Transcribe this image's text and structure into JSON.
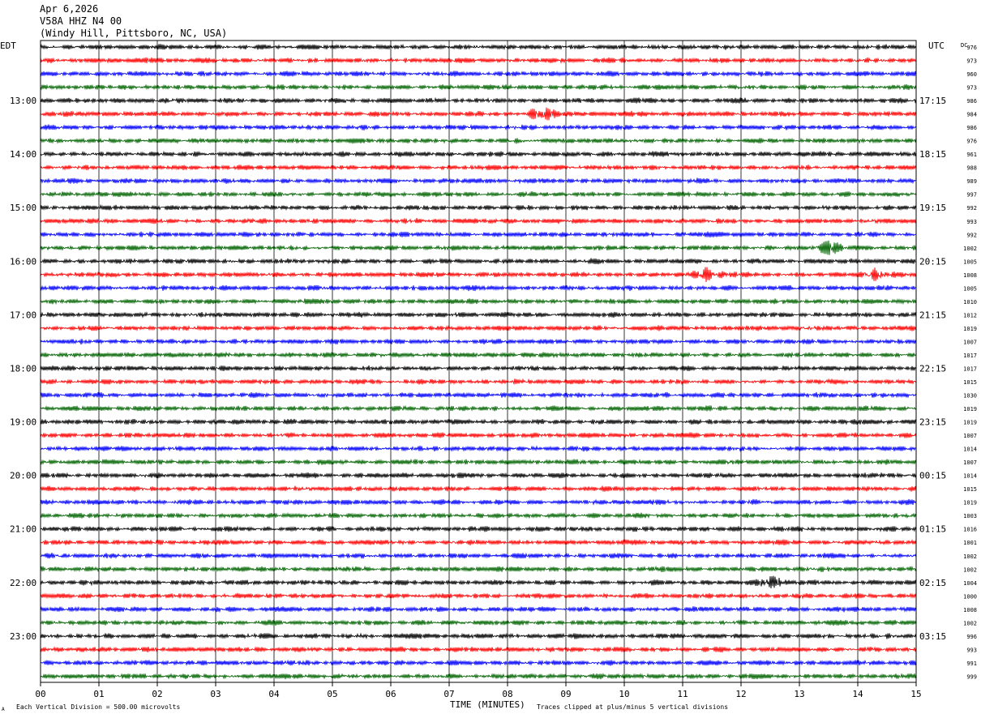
{
  "header": {
    "date": "Apr 6,2026",
    "station": "V58A HHZ N4 00",
    "location": "(Windy Hill, Pittsboro, NC, USA)"
  },
  "labels": {
    "left_tz": "EDT",
    "right_tz": "UTC",
    "dc": "DC",
    "xlabel": "TIME (MINUTES)",
    "scale_note": "Each Vertical Division =  500.00 microvolts",
    "clip_note": "Traces clipped at plus/minus 5 vertical divisions",
    "corner_mark": "A"
  },
  "colors": {
    "trace_cycle": [
      "#000000",
      "#ff0000",
      "#0000ff",
      "#006400"
    ],
    "grid": "#000000",
    "background": "#ffffff"
  },
  "chart_data": {
    "type": "line",
    "description_type": "helicorder",
    "x_ticks": [
      "00",
      "01",
      "02",
      "03",
      "04",
      "05",
      "06",
      "07",
      "08",
      "09",
      "10",
      "11",
      "12",
      "13",
      "14",
      "15"
    ],
    "xlim": [
      0,
      15
    ],
    "left_hour_labels": [
      "13:00",
      "14:00",
      "15:00",
      "16:00",
      "17:00",
      "18:00",
      "19:00",
      "20:00",
      "21:00",
      "22:00",
      "23:00"
    ],
    "right_hour_labels": [
      "17:15",
      "18:15",
      "19:15",
      "20:15",
      "21:15",
      "22:15",
      "23:15",
      "00:15",
      "01:15",
      "02:15",
      "03:15"
    ],
    "dc_values": [
      976,
      973,
      960,
      973,
      986,
      984,
      986,
      976,
      961,
      988,
      989,
      997,
      992,
      993,
      992,
      1002,
      1005,
      1008,
      1005,
      1010,
      1012,
      1019,
      1007,
      1017,
      1017,
      1015,
      1030,
      1019,
      1019,
      1007,
      1014,
      1007,
      1014,
      1015,
      1019,
      1003,
      1016,
      1001,
      1002,
      1002,
      1004,
      1000,
      1008,
      1002,
      996,
      993,
      991,
      999
    ],
    "num_traces": 48,
    "events": [
      {
        "trace": 5,
        "minute": 8.6
      },
      {
        "trace": 17,
        "minute": 11.4
      },
      {
        "trace": 17,
        "minute": 14.3
      },
      {
        "trace": 15,
        "minute": 13.5
      },
      {
        "trace": 40,
        "minute": 12.5
      }
    ]
  }
}
